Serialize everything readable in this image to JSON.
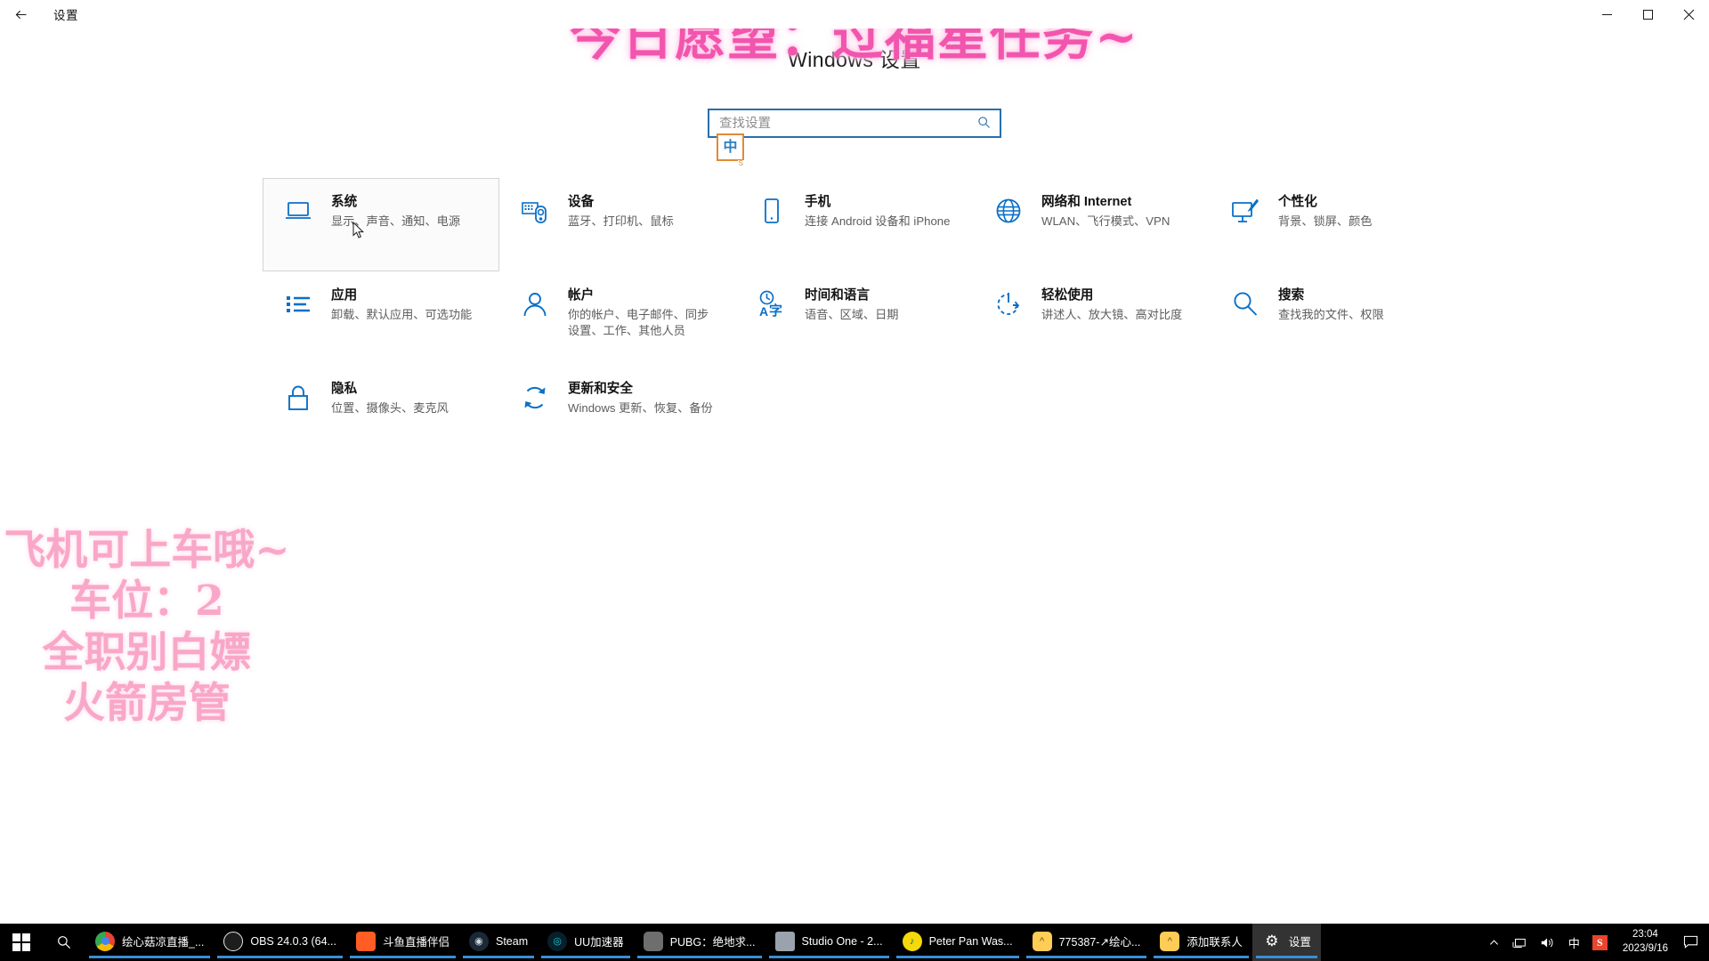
{
  "window": {
    "back_label": "←",
    "title": "设置",
    "minimize_label": "—",
    "maximize_label": "□",
    "close_label": "✕"
  },
  "page": {
    "title": "Windows 设置"
  },
  "search": {
    "placeholder": "查找设置",
    "value": "",
    "icon": "search-icon"
  },
  "ime": {
    "mode_char": "中",
    "badge": "S"
  },
  "tiles": [
    {
      "icon": "monitor-icon",
      "name": "系统",
      "desc": "显示、声音、通知、电源",
      "hovered": true
    },
    {
      "icon": "devices-icon",
      "name": "设备",
      "desc": "蓝牙、打印机、鼠标",
      "hovered": false
    },
    {
      "icon": "phone-icon",
      "name": "手机",
      "desc": "连接 Android 设备和 iPhone",
      "hovered": false
    },
    {
      "icon": "globe-icon",
      "name": "网络和 Internet",
      "desc": "WLAN、飞行模式、VPN",
      "hovered": false
    },
    {
      "icon": "brush-icon",
      "name": "个性化",
      "desc": "背景、锁屏、颜色",
      "hovered": false
    },
    {
      "icon": "applist-icon",
      "name": "应用",
      "desc": "卸载、默认应用、可选功能",
      "hovered": false
    },
    {
      "icon": "person-icon",
      "name": "帐户",
      "desc": "你的帐户、电子邮件、同步设置、工作、其他人员",
      "hovered": false
    },
    {
      "icon": "clock-language-icon",
      "name": "时间和语言",
      "desc": "语音、区域、日期",
      "hovered": false
    },
    {
      "icon": "accessibility-icon",
      "name": "轻松使用",
      "desc": "讲述人、放大镜、高对比度",
      "hovered": false
    },
    {
      "icon": "magnifier-icon",
      "name": "搜索",
      "desc": "查找我的文件、权限",
      "hovered": false
    },
    {
      "icon": "lock-icon",
      "name": "隐私",
      "desc": "位置、摄像头、麦克风",
      "hovered": false
    },
    {
      "icon": "refresh-icon",
      "name": "更新和安全",
      "desc": "Windows 更新、恢复、备份",
      "hovered": false
    }
  ],
  "overlay": {
    "top_text": "今日愿望：过福星任务~",
    "top_color": "#f255ae",
    "left_lines": [
      "飞机可上车哦~",
      "车位：2",
      "全职别白嫖",
      "火箭房管"
    ],
    "left_color": "#f9a7c8"
  },
  "taskbar": {
    "start_icon": "windows-logo-icon",
    "search_icon": "search-icon",
    "apps": [
      {
        "label": "绘心菇凉直播_...",
        "icon": "chrome-icon",
        "color": "#ffffff",
        "active": false,
        "running": true
      },
      {
        "label": "OBS 24.0.3 (64...",
        "icon": "obs-icon",
        "color": "#1c1c1c",
        "active": false,
        "running": true
      },
      {
        "label": "斗鱼直播伴侣",
        "icon": "douyu-icon",
        "color": "#ff5d23",
        "active": false,
        "running": true
      },
      {
        "label": "Steam",
        "icon": "steam-icon",
        "color": "#1b2838",
        "active": false,
        "running": true
      },
      {
        "label": "UU加速器",
        "icon": "uu-icon",
        "color": "#0b2a3a",
        "active": false,
        "running": true
      },
      {
        "label": "PUBG：绝地求...",
        "icon": "pubg-icon",
        "color": "#6b6b6b",
        "active": false,
        "running": true
      },
      {
        "label": "Studio One - 2...",
        "icon": "studioone-icon",
        "color": "#9aa3ad",
        "active": false,
        "running": true
      },
      {
        "label": "Peter Pan Was...",
        "icon": "music-icon",
        "color": "#f5d90a",
        "active": false,
        "running": true
      },
      {
        "label": "775387-↗绘心...",
        "icon": "cat-icon",
        "color": "#ffcc55",
        "active": false,
        "running": true
      },
      {
        "label": "添加联系人",
        "icon": "cat-icon",
        "color": "#ffcc55",
        "active": false,
        "running": true
      },
      {
        "label": "设置",
        "icon": "gear-icon",
        "color": "#333333",
        "active": true,
        "running": true
      }
    ],
    "tray": {
      "chevron": "⌃",
      "network_icon": "network-icon",
      "volume_icon": "volume-icon",
      "ime_label": "中",
      "sogou_label": "S",
      "time": "23:04",
      "date": "2023/9/16",
      "action_center_icon": "action-center-icon"
    }
  }
}
